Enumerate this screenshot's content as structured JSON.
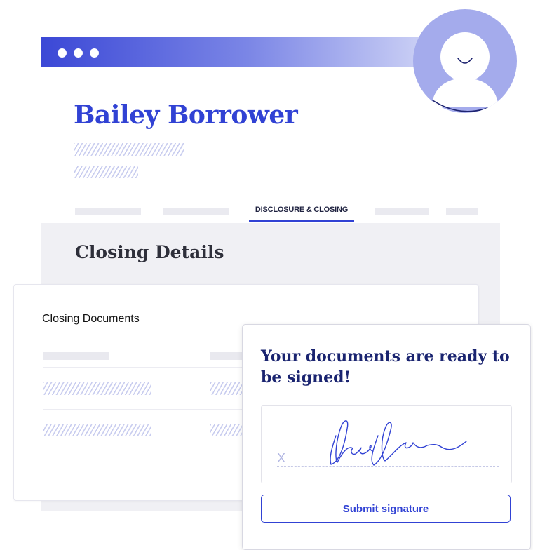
{
  "window": {
    "title_dots": [
      "dot",
      "dot",
      "dot"
    ]
  },
  "profile": {
    "name": "Bailey Borrower"
  },
  "tabs": {
    "active_label": "DISCLOSURE & CLOSING"
  },
  "section": {
    "title": "Closing Details"
  },
  "documents_card": {
    "title": "Closing Documents"
  },
  "signature_card": {
    "heading": "Your documents are ready to be signed!",
    "sign_marker": "X",
    "submit_label": "Submit signature"
  },
  "colors": {
    "brand_blue": "#3142d4",
    "navy": "#1a2470",
    "avatar_purple": "#a4abec"
  },
  "icons": {
    "avatar": "user-avatar-icon",
    "signature": "handwritten-signature"
  }
}
